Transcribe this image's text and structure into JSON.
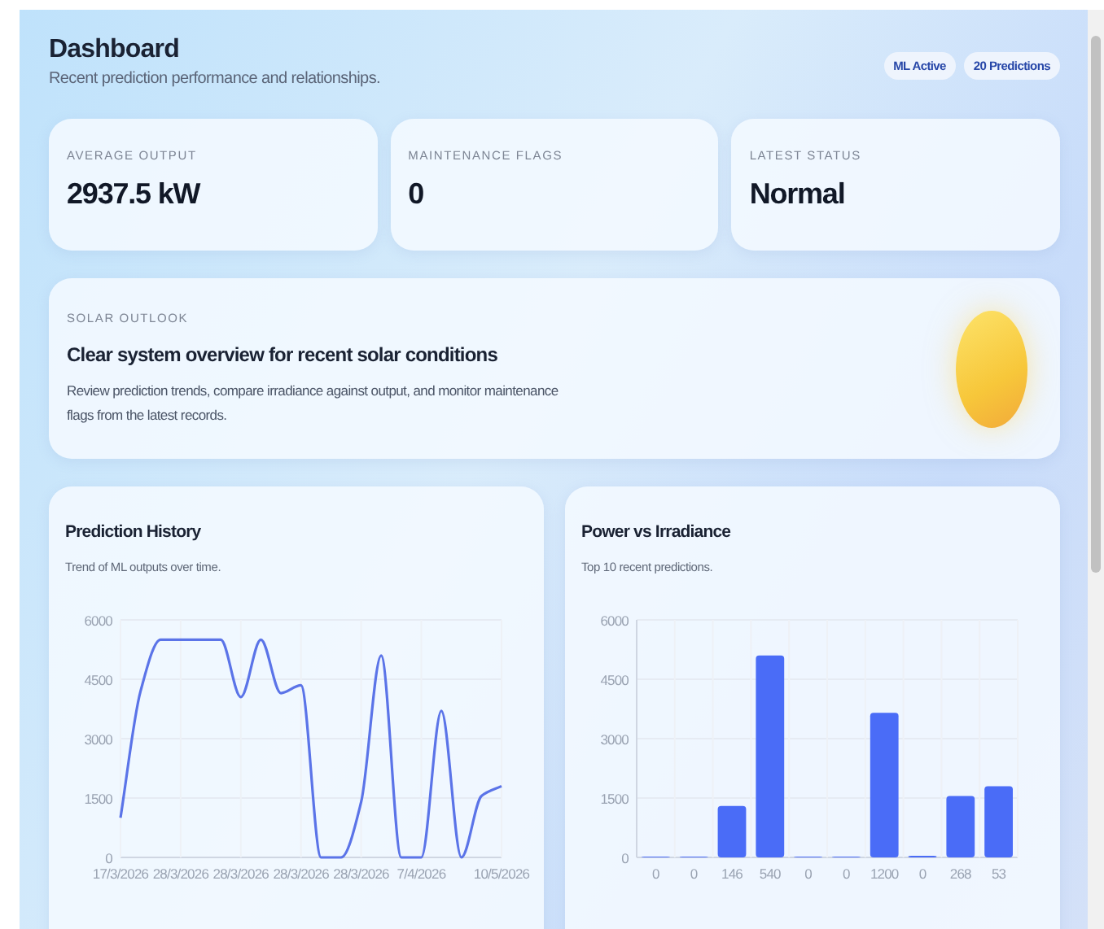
{
  "header": {
    "title": "Dashboard",
    "subtitle": "Recent prediction performance and relationships.",
    "badges": [
      "ML Active",
      "20 Predictions"
    ]
  },
  "stats": [
    {
      "label": "AVERAGE OUTPUT",
      "value": "2937.5 kW"
    },
    {
      "label": "MAINTENANCE FLAGS",
      "value": "0"
    },
    {
      "label": "LATEST STATUS",
      "value": "Normal"
    }
  ],
  "outlook": {
    "eyebrow": "SOLAR OUTLOOK",
    "title": "Clear system overview for recent solar conditions",
    "text": "Review prediction trends, compare irradiance against output, and monitor maintenance flags from the latest records."
  },
  "charts": [
    {
      "title": "Prediction History",
      "subtitle": "Trend of ML outputs over time.",
      "chart_data": {
        "type": "line",
        "grid": true,
        "categories": [
          "17/3/2026",
          null,
          null,
          "28/3/2026",
          null,
          null,
          "28/3/2026",
          null,
          null,
          "28/3/2026",
          null,
          null,
          "28/3/2026",
          null,
          null,
          "7/4/2026",
          null,
          null,
          null,
          "10/5/2026"
        ],
        "series": [
          {
            "color": "#5b74e8",
            "values": [
              1000,
              4200,
              5500,
              5500,
              5500,
              5500,
              4050,
              5500,
              4150,
              4350,
              0,
              0,
              1400,
              5100,
              0,
              0,
              3700,
              0,
              1550,
              1800
            ]
          }
        ],
        "ylim": [
          0,
          6000
        ],
        "yticks": [
          0,
          1500,
          3000,
          4500,
          6000
        ]
      }
    },
    {
      "title": "Power vs Irradiance",
      "subtitle": "Top 10 recent predictions.",
      "chart_data": {
        "type": "bar",
        "grid": true,
        "categories": [
          "0",
          "0",
          "146",
          "540",
          "0",
          "0",
          "1200",
          "0",
          "268",
          "53"
        ],
        "series": [
          {
            "color": "#4a6cf7",
            "values": [
              20,
              20,
              1300,
              5100,
              20,
              20,
              3650,
              40,
              1550,
              1800
            ]
          }
        ],
        "ylim": [
          0,
          6000
        ],
        "yticks": [
          0,
          1500,
          3000,
          4500,
          6000
        ]
      }
    }
  ]
}
